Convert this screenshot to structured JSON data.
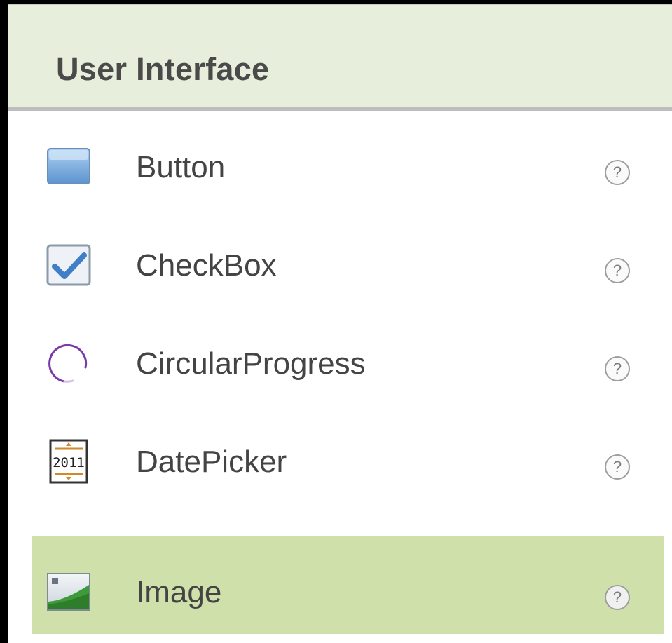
{
  "palette": {
    "category_title": "User Interface",
    "items": [
      {
        "label": "Button",
        "icon": "button-icon",
        "help": "?"
      },
      {
        "label": "CheckBox",
        "icon": "checkbox-icon",
        "help": "?"
      },
      {
        "label": "CircularProgress",
        "icon": "circular-progress-icon",
        "help": "?"
      },
      {
        "label": "DatePicker",
        "icon": "date-picker-icon",
        "help": "?",
        "icon_text": "2011"
      },
      {
        "label": "Image",
        "icon": "image-icon",
        "help": "?",
        "selected": true
      }
    ]
  },
  "colors": {
    "header_bg": "#e7eedc",
    "selected_bg": "#cfe0aa",
    "text": "#444444"
  }
}
